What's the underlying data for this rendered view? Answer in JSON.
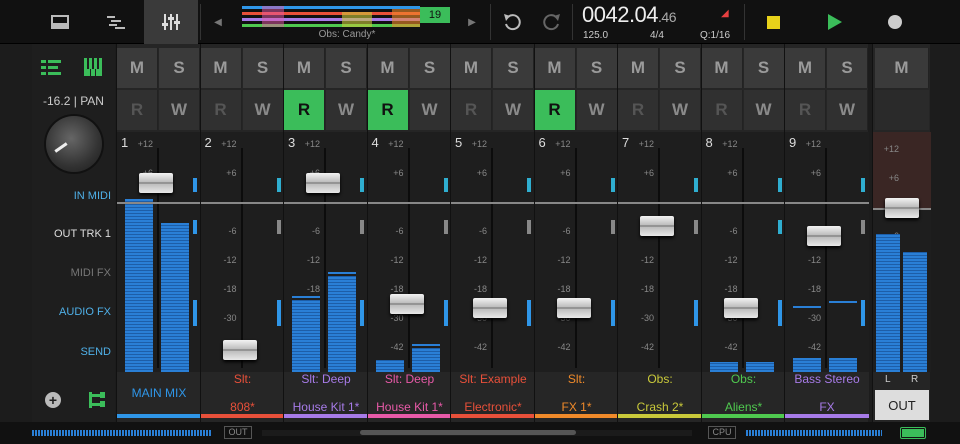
{
  "top": {
    "obs_label": "Obs: Candy*",
    "bar_count": "19",
    "time_main": "0042.04",
    "time_frac": ".46",
    "tempo": "125.0",
    "signature": "4/4",
    "quantize": "Q:1/16"
  },
  "left": {
    "level": "-16.2",
    "pan_sep": "|",
    "pan": "PAN",
    "items": [
      "IN MIDI",
      "OUT TRK 1",
      "MIDI FX",
      "AUDIO FX",
      "SEND"
    ]
  },
  "labels": {
    "M": "M",
    "S": "S",
    "R": "R",
    "W": "W",
    "L": "L",
    "Rr": "R",
    "out": "OUT"
  },
  "scale_labels": [
    "+12",
    "+6",
    "-6",
    "-12",
    "-18",
    "-30",
    "-42"
  ],
  "strips": [
    {
      "num": "1",
      "name1": "MAIN MIX",
      "name2": "",
      "color": "#2f96e8",
      "rec": false,
      "knob_db": 4
    },
    {
      "num": "2",
      "name1": "Slt:",
      "name2": "808*",
      "color": "#e8503a",
      "rec": false,
      "knob_db": -44
    },
    {
      "num": "3",
      "name1": "Slt: Deep",
      "name2": "House Kit 1*",
      "color": "#a77be8",
      "rec": true,
      "knob_db": 4
    },
    {
      "num": "4",
      "name1": "Slt: Deep",
      "name2": "House Kit 1*",
      "color": "#e85aa8",
      "rec": true,
      "knob_db": -24
    },
    {
      "num": "5",
      "name1": "Slt: Example",
      "name2": "Electronic*",
      "color": "#e8503a",
      "rec": false,
      "knob_db": -26
    },
    {
      "num": "6",
      "name1": "Slt:",
      "name2": "FX 1*",
      "color": "#f08a2a",
      "rec": true,
      "knob_db": -26
    },
    {
      "num": "7",
      "name1": "Obs:",
      "name2": "Crash 2*",
      "color": "#c9c93a",
      "rec": false,
      "knob_db": -5
    },
    {
      "num": "8",
      "name1": "Obs:",
      "name2": "Aliens*",
      "color": "#4fc94f",
      "rec": false,
      "knob_db": -26
    },
    {
      "num": "9",
      "name1": "Bass Stereo",
      "name2": "FX",
      "color": "#a77be8",
      "rec": false,
      "knob_db": -7
    }
  ],
  "bottom": {
    "out": "OUT",
    "cpu": "CPU"
  },
  "colors": {
    "accent_green": "#3bbd5a",
    "meter_blue": "#2a7fd6"
  }
}
